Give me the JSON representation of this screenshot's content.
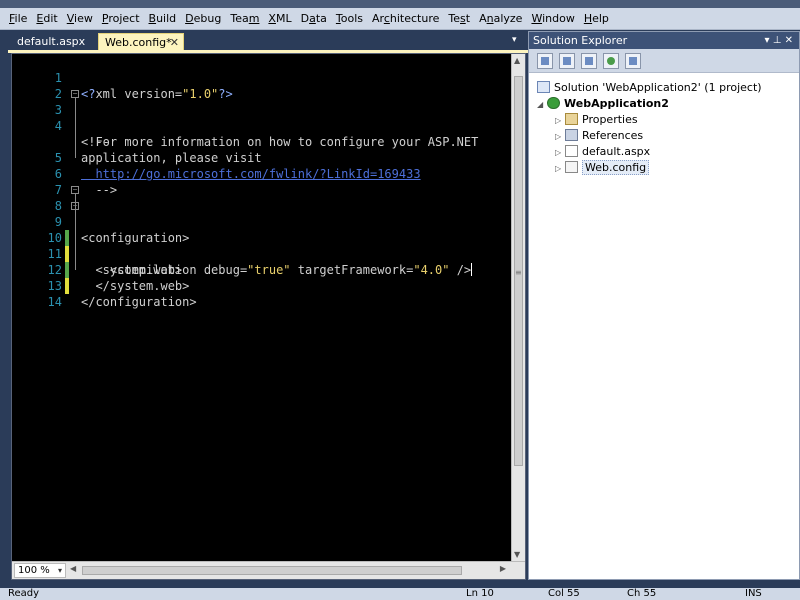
{
  "menubar": {
    "items": [
      {
        "accel": "F",
        "rest": "ile"
      },
      {
        "accel": "E",
        "rest": "dit"
      },
      {
        "accel": "V",
        "rest": "iew"
      },
      {
        "accel": "P",
        "rest": "roject"
      },
      {
        "accel": "B",
        "rest": "uild"
      },
      {
        "accel": "D",
        "rest": "ebug"
      },
      {
        "accel": "",
        "rest": "Tea",
        "accel2": "m"
      },
      {
        "accel": "X",
        "rest": "ML"
      },
      {
        "accel": "",
        "rest": "D",
        "accel2": "a",
        "rest2": "ta"
      },
      {
        "accel": "T",
        "rest": "ools"
      },
      {
        "accel": "",
        "rest": "Ar",
        "accel2": "c",
        "rest2": "hitecture"
      },
      {
        "accel": "",
        "rest": "Te",
        "accel2": "s",
        "rest2": "t"
      },
      {
        "accel": "",
        "rest": "A",
        "accel2": "n",
        "rest2": "alyze"
      },
      {
        "accel": "W",
        "rest": "indow"
      },
      {
        "accel": "H",
        "rest": "elp"
      }
    ]
  },
  "tabs": {
    "inactive_label": "default.aspx",
    "active_label": "Web.config*",
    "close_glyph": "✕"
  },
  "editor": {
    "line_numbers": [
      "1",
      "2",
      "3",
      "4",
      "",
      "5",
      "6",
      "7",
      "8",
      "9",
      "10",
      "11",
      "12",
      "13",
      "14"
    ],
    "code_line1_open": "<?",
    "code_line1_name": "xml version=",
    "code_line1_val": "\"1.0\"",
    "code_line1_close": "?>",
    "code_line3": "<!--",
    "code_line4a": "  For more information on how to configure your ASP.NET",
    "code_line4b": "application, please visit",
    "code_line5": "  http://go.microsoft.com/fwlink/?LinkId=169433",
    "code_line6": "  -->",
    "code_line8": "<configuration>",
    "code_line9": "  <system.web>",
    "code_line10_tag": "    <compilation",
    "code_line10_attr1": " debug=",
    "code_line10_val1": "\"true\"",
    "code_line10_attr2": " targetFramework=",
    "code_line10_val2": "\"4.0\"",
    "code_line10_end": " />",
    "code_line11": "  </system.web>",
    "code_line13": "</configuration>",
    "zoom": "100 %"
  },
  "solution_explorer": {
    "title": "Solution Explorer",
    "pin_glyph": "▾ ⊥ ✕",
    "nodes": [
      {
        "label": "Solution 'WebApplication2' (1 project)",
        "icon": "solution-icon"
      },
      {
        "label": "WebApplication2",
        "icon": "project-icon"
      },
      {
        "label": "Properties",
        "icon": "folder-icon"
      },
      {
        "label": "References",
        "icon": "references-icon"
      },
      {
        "label": "default.aspx",
        "icon": "page-icon"
      },
      {
        "label": "Web.config",
        "icon": "config-icon"
      }
    ]
  },
  "statusbar": {
    "status": "Ready",
    "ln": "Ln 10",
    "col": "Col 55",
    "ch": "Ch 55",
    "ins": "INS"
  },
  "colors": {
    "editor_bg": "#000000",
    "line_number": "#2b91af",
    "string": "#e9d06c",
    "punct": "#8fb0ff",
    "active_tab": "#fdf4bf",
    "chrome": "#cfd8e6"
  }
}
